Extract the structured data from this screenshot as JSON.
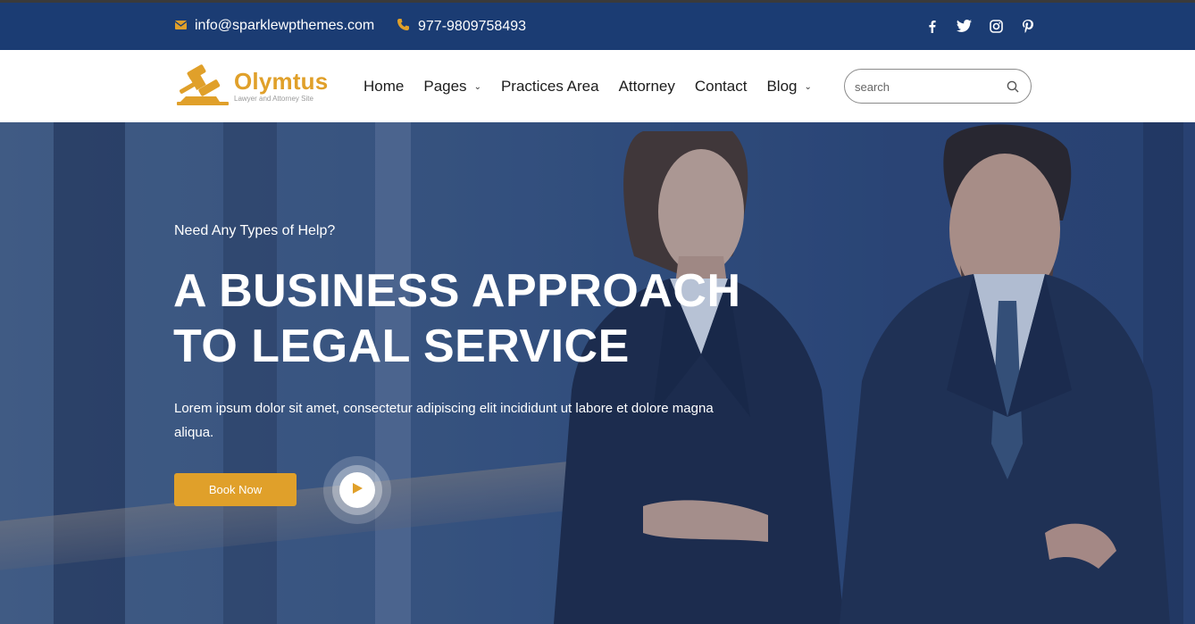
{
  "topbar": {
    "email": "info@sparklewpthemes.com",
    "phone": "977-9809758493",
    "social": [
      "facebook-icon",
      "twitter-icon",
      "instagram-icon",
      "pinterest-icon"
    ]
  },
  "header": {
    "logo": {
      "name": "Olymtus",
      "tagline": "Lawyer and Attorney Site"
    },
    "nav": [
      {
        "label": "Home",
        "dropdown": false
      },
      {
        "label": "Pages",
        "dropdown": true
      },
      {
        "label": "Practices Area",
        "dropdown": false
      },
      {
        "label": "Attorney",
        "dropdown": false
      },
      {
        "label": "Contact",
        "dropdown": false
      },
      {
        "label": "Blog",
        "dropdown": true
      }
    ],
    "search": {
      "placeholder": "search",
      "value": ""
    }
  },
  "hero": {
    "eyebrow": "Need Any Types of Help?",
    "headline_line1": "A BUSINESS APPROACH",
    "headline_line2": "TO LEGAL SERVICE",
    "description": "Lorem ipsum dolor sit amet, consectetur adipiscing elit incididunt ut labore et dolore magna aliqua.",
    "cta_label": "Book Now"
  },
  "colors": {
    "topbar_bg": "#1b3c73",
    "accent": "#e0a02a",
    "header_bg": "#ffffff",
    "text_dark": "#1d1d1d"
  }
}
